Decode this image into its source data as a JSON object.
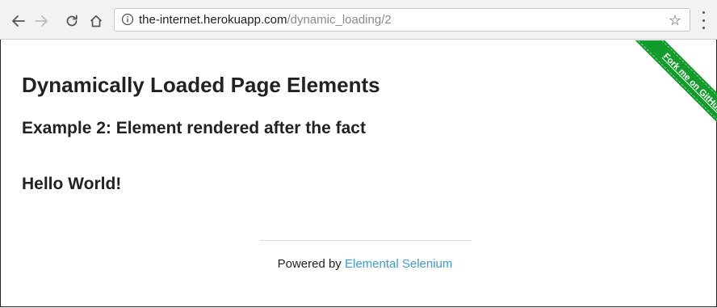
{
  "browser": {
    "url_host": "the-internet.herokuapp.com",
    "url_path": "/dynamic_loading/2",
    "icons": {
      "back": "arrow-left-icon",
      "forward": "arrow-right-icon",
      "reload": "reload-icon",
      "home": "home-icon",
      "info": "info-icon",
      "bookmark": "star-icon",
      "menu": "kebab-menu-icon"
    }
  },
  "page": {
    "title": "Dynamically Loaded Page Elements",
    "example_title": "Example 2: Element rendered after the fact",
    "finish_text": "Hello World!"
  },
  "ribbon": {
    "label": "Fork me on GitHub",
    "color": "#139b2c"
  },
  "footer": {
    "prefix": "Powered by",
    "link_label": "Elemental Selenium",
    "link_color": "#3a9bd9"
  }
}
